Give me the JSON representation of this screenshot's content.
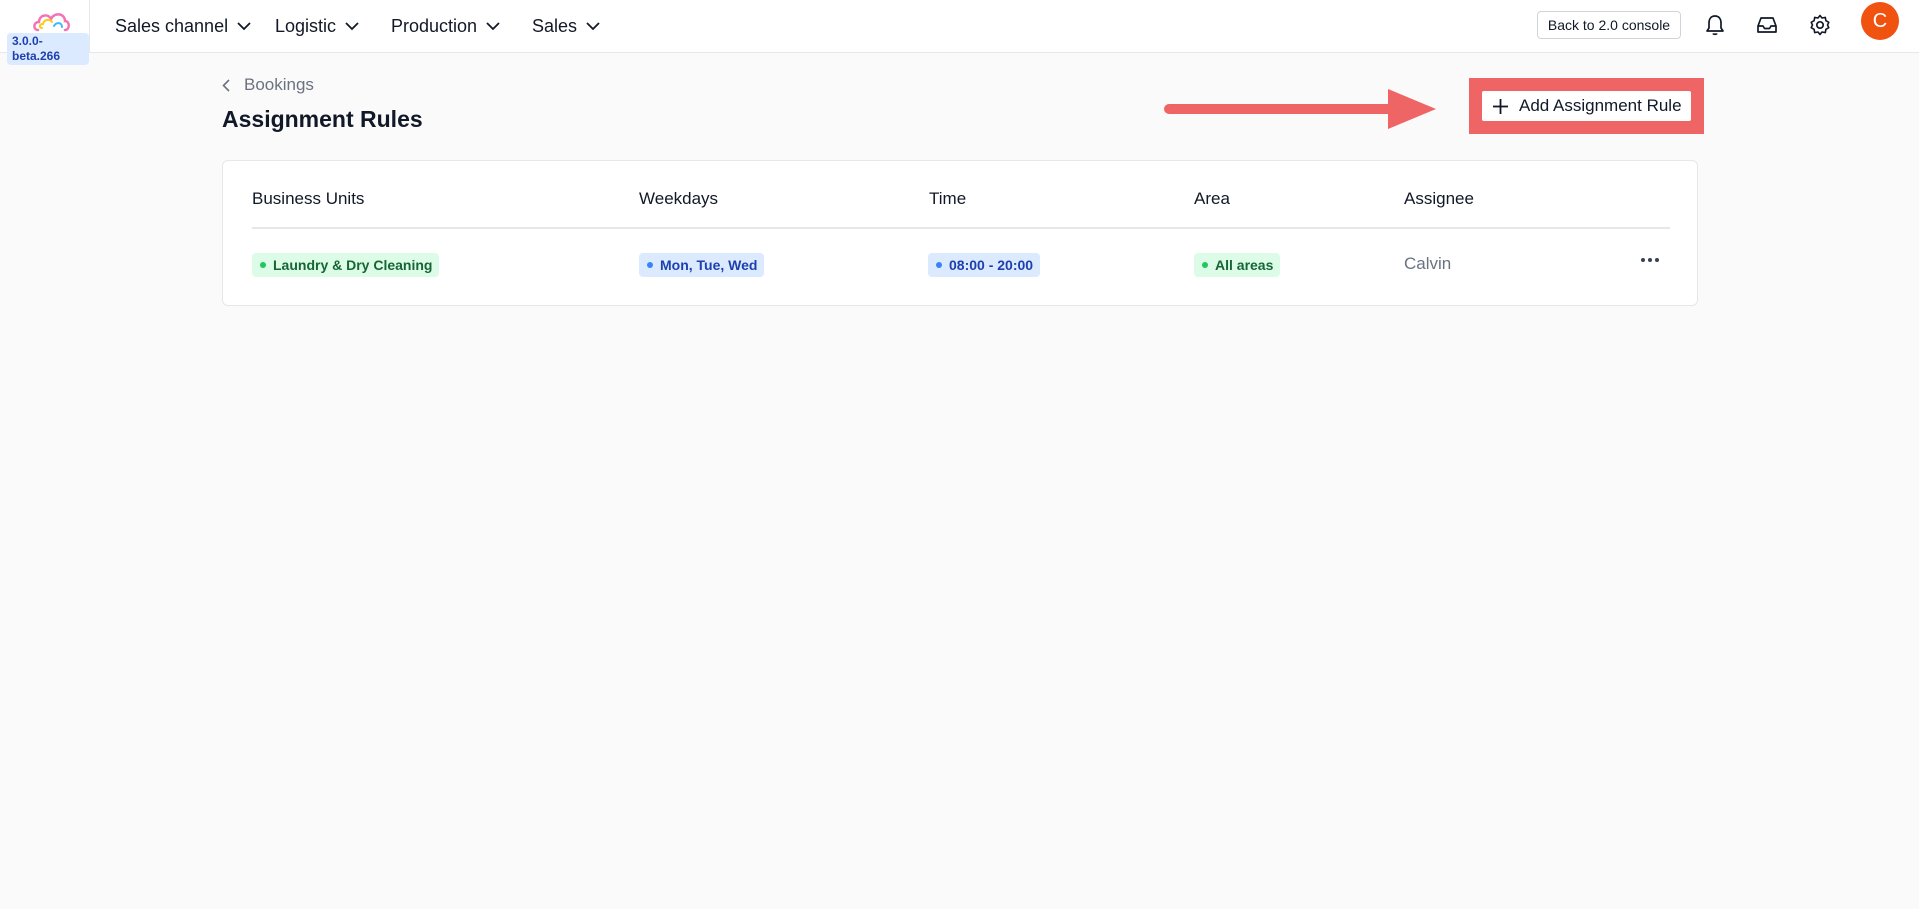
{
  "app": {
    "version": "3.0.0-beta.266",
    "colors": {
      "avatar": "#f0520f",
      "highlight": "#ef6464",
      "tag_green": "#dcfce7",
      "tag_blue": "#dbeafe"
    }
  },
  "nav": {
    "items": [
      {
        "label": "Sales channel",
        "icon": "chevron-down-icon"
      },
      {
        "label": "Logistic",
        "icon": "chevron-down-icon"
      },
      {
        "label": "Production",
        "icon": "chevron-down-icon"
      },
      {
        "label": "Sales",
        "icon": "chevron-down-icon"
      }
    ],
    "console_button": "Back to 2.0 console",
    "icons": [
      "bell-icon",
      "inbox-icon",
      "gear-icon"
    ],
    "avatar_initial": "C"
  },
  "page": {
    "breadcrumb": "Bookings",
    "title": "Assignment Rules",
    "add_button": "Add Assignment Rule"
  },
  "table": {
    "columns": [
      "Business Units",
      "Weekdays",
      "Time",
      "Area",
      "Assignee"
    ],
    "rows": [
      {
        "business_unit": "Laundry & Dry Cleaning",
        "weekdays": "Mon, Tue, Wed",
        "time": "08:00 - 20:00",
        "area": "All areas",
        "assignee": "Calvin"
      }
    ]
  }
}
